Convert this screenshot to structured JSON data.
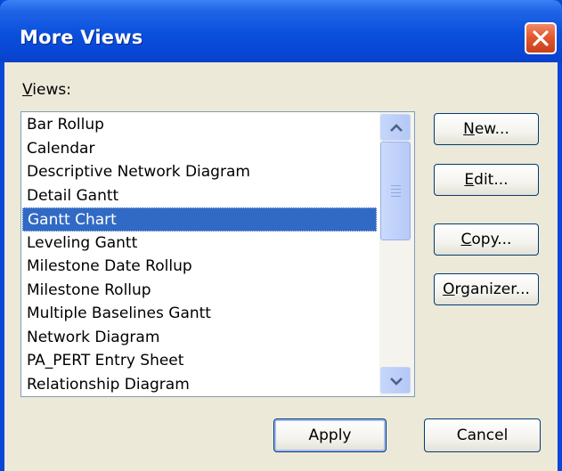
{
  "dialog": {
    "title": "More Views",
    "close_icon": "close-x-icon"
  },
  "views_label": "Views:",
  "views": [
    "Bar Rollup",
    "Calendar",
    "Descriptive Network Diagram",
    "Detail Gantt",
    "Gantt Chart",
    "Leveling Gantt",
    "Milestone Date Rollup",
    "Milestone Rollup",
    "Multiple Baselines Gantt",
    "Network Diagram",
    "PA_PERT Entry Sheet",
    "Relationship Diagram"
  ],
  "selected_view": "Gantt Chart",
  "side_buttons": {
    "new_label": "New...",
    "edit_label": "Edit...",
    "copy_label": "Copy...",
    "organizer_label": "Organizer..."
  },
  "footer_buttons": {
    "apply_label": "Apply",
    "cancel_label": "Cancel"
  },
  "colors": {
    "title_bar": "#0a4fdc",
    "selection": "#316ac5",
    "close_button": "#e2582f",
    "dialog_face": "#ece9d8"
  }
}
